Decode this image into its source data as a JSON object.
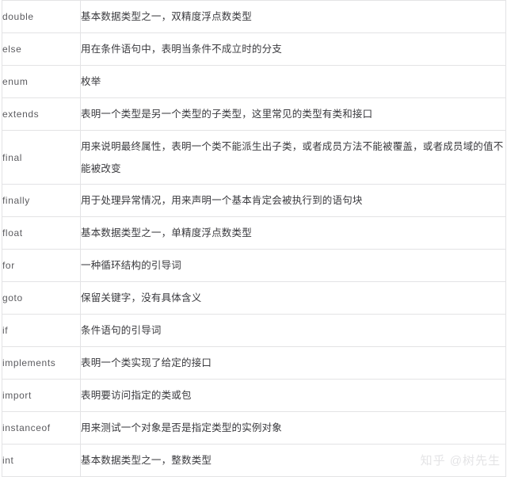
{
  "table": {
    "rows": [
      {
        "keyword": "double",
        "description": "基本数据类型之一，双精度浮点数类型"
      },
      {
        "keyword": "else",
        "description": "用在条件语句中，表明当条件不成立时的分支"
      },
      {
        "keyword": "enum",
        "description": "枚举"
      },
      {
        "keyword": "extends",
        "description": "表明一个类型是另一个类型的子类型，这里常见的类型有类和接口"
      },
      {
        "keyword": "final",
        "description": "用来说明最终属性，表明一个类不能派生出子类，或者成员方法不能被覆盖，或者成员域的值不能被改变",
        "tall": true
      },
      {
        "keyword": "finally",
        "description": "用于处理异常情况，用来声明一个基本肯定会被执行到的语句块"
      },
      {
        "keyword": "float",
        "description": "基本数据类型之一，单精度浮点数类型"
      },
      {
        "keyword": "for",
        "description": "一种循环结构的引导词"
      },
      {
        "keyword": "goto",
        "description": "保留关键字，没有具体含义"
      },
      {
        "keyword": "if",
        "description": "条件语句的引导词"
      },
      {
        "keyword": "implements",
        "description": "表明一个类实现了给定的接口"
      },
      {
        "keyword": "import",
        "description": "表明要访问指定的类或包"
      },
      {
        "keyword": "instanceof",
        "description": "用来测试一个对象是否是指定类型的实例对象"
      },
      {
        "keyword": "int",
        "description": "基本数据类型之一，整数类型"
      }
    ]
  },
  "watermark": {
    "text": "知乎 @树先生"
  },
  "colors": {
    "border": "#e3e3e5",
    "keyword_text": "#5b5b5f",
    "description_text": "#3a3a3e",
    "watermark_text": "#e4e4e6",
    "background": "#ffffff"
  }
}
